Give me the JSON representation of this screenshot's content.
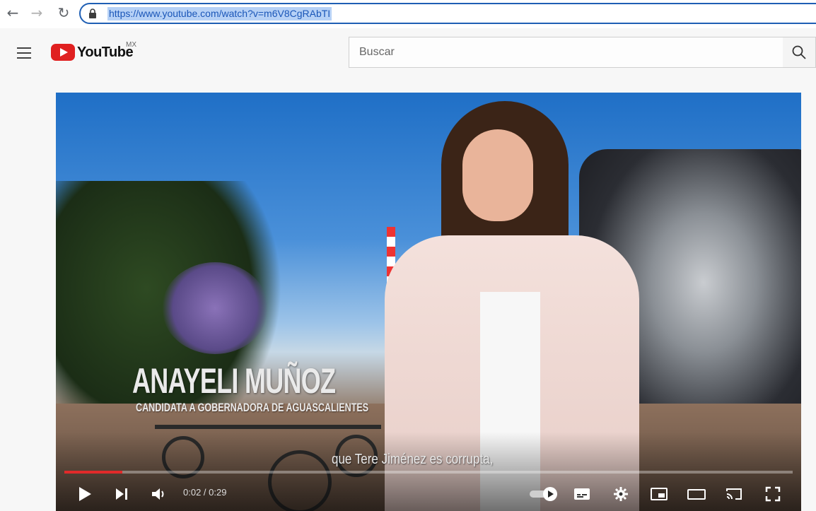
{
  "browser": {
    "url": "https://www.youtube.com/watch?v=m6V8CgRAbTI"
  },
  "youtube": {
    "logo_text": "YouTube",
    "region": "MX",
    "search_placeholder": "Buscar"
  },
  "video": {
    "lower_third_name": "ANAYELI MUÑOZ",
    "lower_third_title": "CANDIDATA A GOBERNADORA DE AGUASCALIENTES",
    "caption": "que Tere Jiménez es corrupta,",
    "time_display": "0:02 / 0:29",
    "progress_fraction": 0.08
  },
  "colors": {
    "accent": "#e12a2a",
    "link": "#1a56b8"
  }
}
